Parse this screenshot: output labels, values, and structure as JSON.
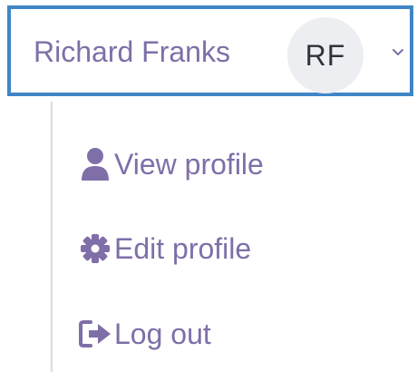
{
  "user_menu": {
    "name": "Richard Franks",
    "initials": "RF",
    "chevron_icon": "chevron-down-icon"
  },
  "dropdown": {
    "items": [
      {
        "label": "View profile",
        "icon": "user-icon"
      },
      {
        "label": "Edit profile",
        "icon": "gear-icon"
      },
      {
        "label": "Log out",
        "icon": "logout-icon"
      }
    ]
  },
  "colors": {
    "accent_text": "#7f6fa8",
    "border_focus": "#3f86c7",
    "avatar_bg": "#eceef1",
    "avatar_text": "#2f3338"
  }
}
